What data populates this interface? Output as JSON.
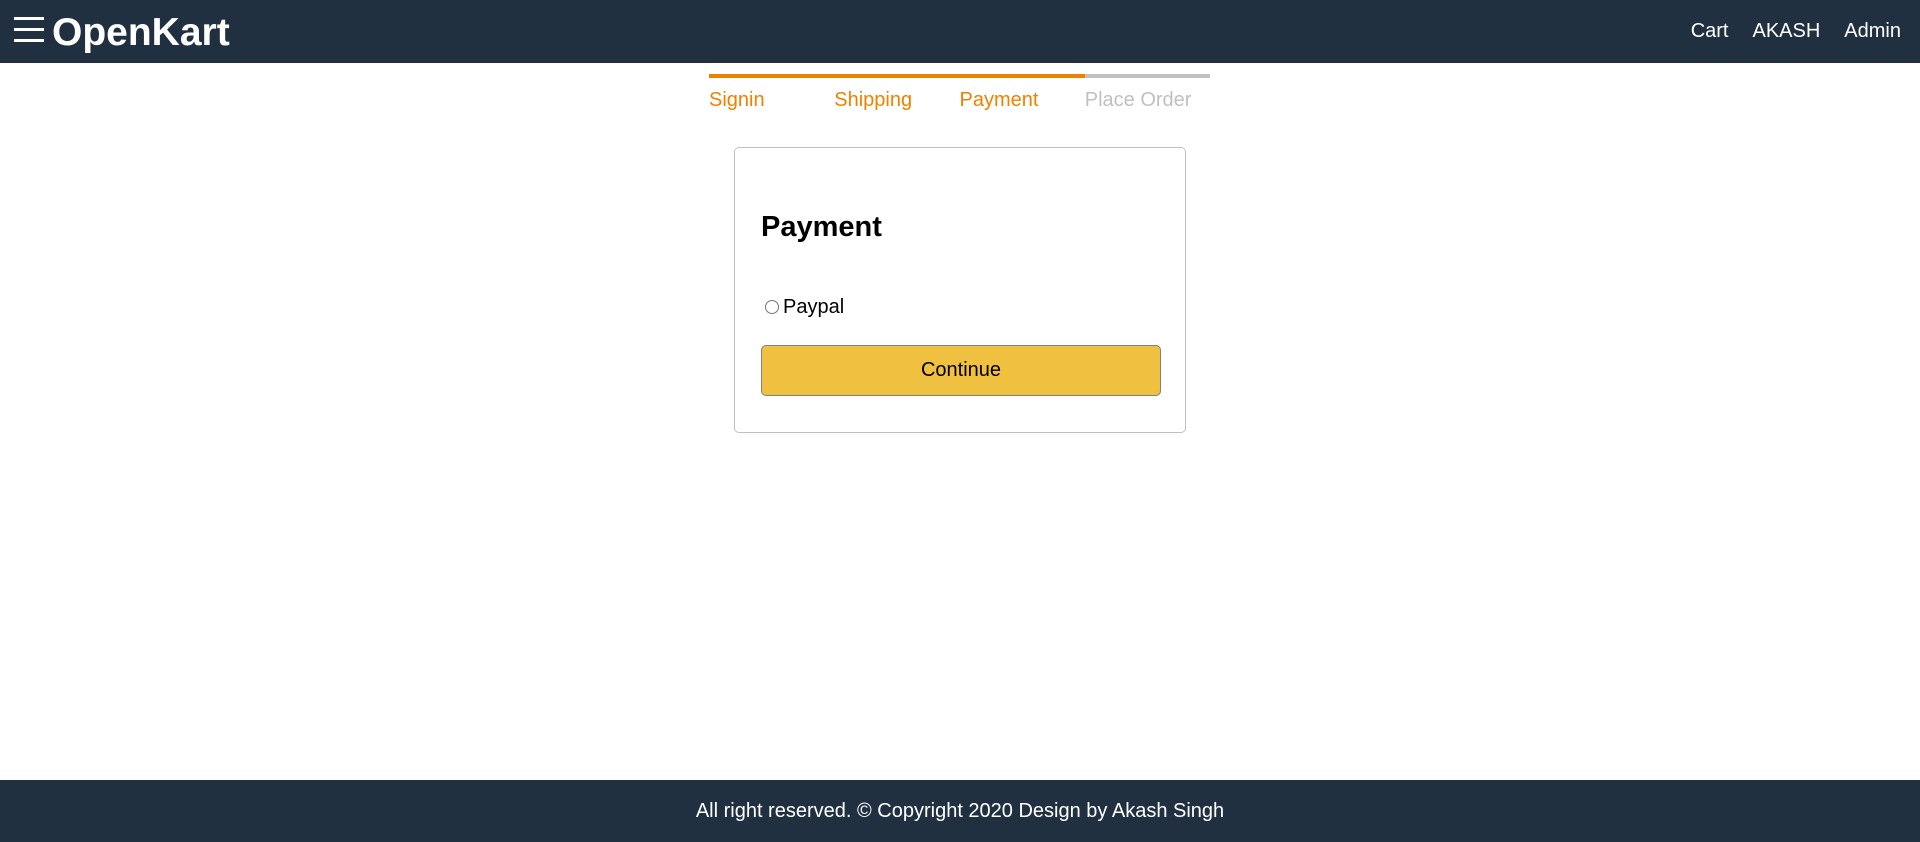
{
  "header": {
    "brand": "OpenKart",
    "menu_icon": "hamburger-menu-icon",
    "nav": {
      "cart": "Cart",
      "user": "AKASH",
      "admin": "Admin"
    }
  },
  "steps": [
    {
      "label": "Signin",
      "active": true
    },
    {
      "label": "Shipping",
      "active": true
    },
    {
      "label": "Payment",
      "active": true
    },
    {
      "label": "Place Order",
      "active": false
    }
  ],
  "payment": {
    "title": "Payment",
    "options": [
      {
        "label": "Paypal",
        "selected": false
      }
    ],
    "continue_label": "Continue"
  },
  "footer": {
    "text": "All right reserved. © Copyright 2020 Design by Akash Singh"
  },
  "colors": {
    "header_bg": "#203040",
    "step_active": "#f08000",
    "step_inactive": "#c0c0c0",
    "button_bg": "#f0c040"
  }
}
